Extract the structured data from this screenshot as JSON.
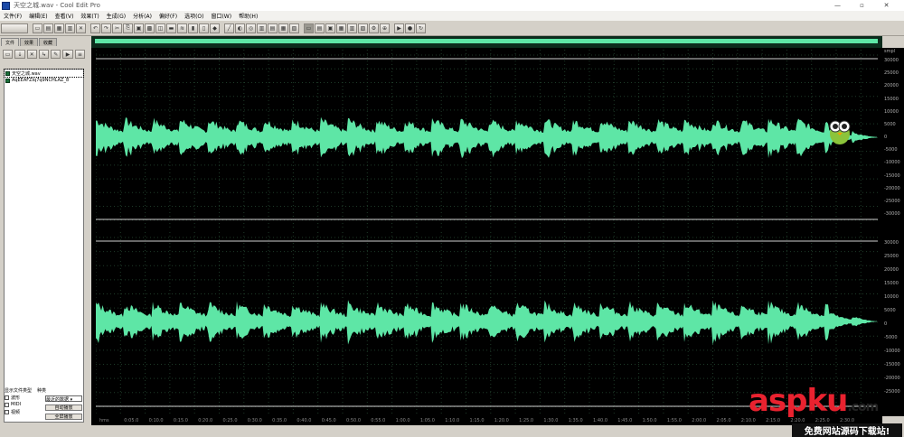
{
  "window": {
    "title": "天空之城.wav - Cool Edit Pro",
    "controls": [
      "—",
      "▫",
      "✕"
    ]
  },
  "menu": [
    "文件(F)",
    "编辑(E)",
    "查看(V)",
    "效果(T)",
    "生成(G)",
    "分析(A)",
    "偏好(F)",
    "选项(O)",
    "窗口(W)",
    "帮助(H)"
  ],
  "panel": {
    "tabs": [
      "文件",
      "效果",
      "收藏"
    ],
    "files": [
      "天空之城.wav",
      "AqEEAFZIq7q9NCHLAZ_8"
    ],
    "filter_label": "显示文件类型",
    "sort_label": "种类",
    "types": [
      "波形",
      "MIDI",
      "视频"
    ],
    "sort_value": "最近的数据",
    "btn1": "自动播放",
    "btn2": "全屏播放"
  },
  "ruler": {
    "unit": "smpl",
    "ch1": [
      "30000",
      "25000",
      "20000",
      "15000",
      "10000",
      "5000",
      "0",
      "-5000",
      "-10000",
      "-15000",
      "-20000",
      "-25000",
      "-30000"
    ],
    "ch2": [
      "30000",
      "25000",
      "20000",
      "15000",
      "10000",
      "5000",
      "0",
      "-5000",
      "-10000",
      "-15000",
      "-20000",
      "-25000"
    ]
  },
  "timeline": [
    "hms",
    "0:05.0",
    "0:10.0",
    "0:15.0",
    "0:20.0",
    "0:25.0",
    "0:30.0",
    "0:35.0",
    "0:40.0",
    "0:45.0",
    "0:50.0",
    "0:55.0",
    "1:00.0",
    "1:05.0",
    "1:10.0",
    "1:15.0",
    "1:20.0",
    "1:25.0",
    "1:30.0",
    "1:35.0",
    "1:40.0",
    "1:45.0",
    "1:50.0",
    "1:55.0",
    "2:00.0",
    "2:05.0",
    "2:10.0",
    "2:15.0",
    "2:20.0",
    "2:25.0",
    "2:30.0"
  ],
  "colors": {
    "wave": "#5ee6a6",
    "background": "#000000",
    "grid": "#1e3a28",
    "centerline": "#cfcfcf"
  },
  "watermark": {
    "brand": "aspku",
    "tld": ".com",
    "tagline": "免费网站源码下载站!"
  },
  "icons": [
    "new-file-icon",
    "open-icon",
    "save-icon",
    "undo-icon",
    "play-icon",
    "stop-icon",
    "loop-icon",
    "zoom-in-icon",
    "zoom-out-icon",
    "mascot-icon"
  ]
}
